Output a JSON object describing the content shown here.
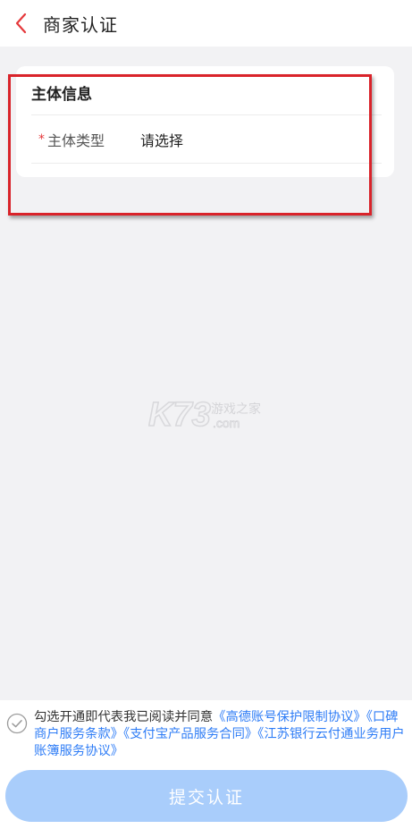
{
  "header": {
    "title": "商家认证",
    "back_icon": "chevron-left-icon"
  },
  "card": {
    "section_title": "主体信息",
    "field": {
      "required_mark": "*",
      "label": "主体类型",
      "value": "请选择"
    }
  },
  "watermark": {
    "brand": "K73",
    "tagline": "游戏之家",
    "domain": ".com"
  },
  "footer": {
    "agreement_prefix": "勾选开通即代表我已阅读并同意",
    "links": [
      "《高德账号保护限制协议》",
      "《口碑商户服务条款》",
      "《支付宝产品服务合同》",
      "《江苏银行云付通业务用户账簿服务协议》"
    ],
    "submit_label": "提交认证"
  },
  "colors": {
    "accent_red": "#e5383b",
    "link_blue": "#2f7df6",
    "button_disabled": "#a9cdfb",
    "highlight_red": "#d9232a"
  }
}
